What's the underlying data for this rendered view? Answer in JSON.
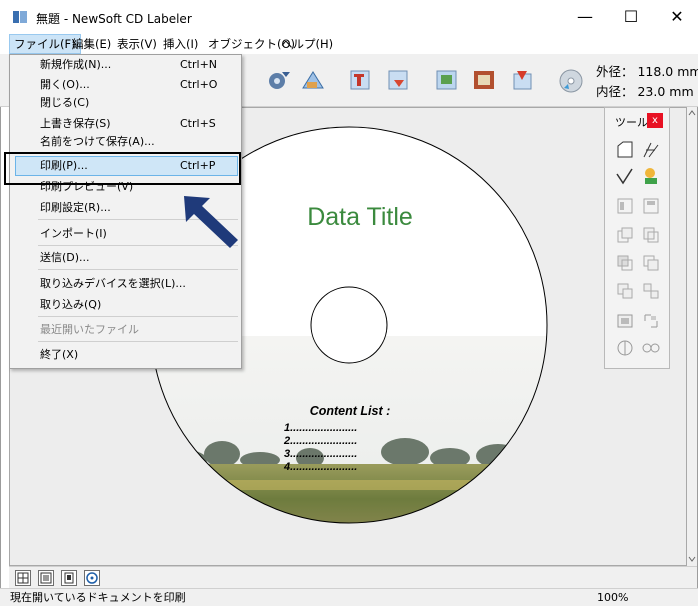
{
  "window": {
    "title": "無題 - NewSoft CD Labeler",
    "minimize_glyph": "—",
    "maximize_glyph": "☐",
    "close_glyph": "✕"
  },
  "menubar": {
    "items": [
      {
        "label": "ファイル(F)"
      },
      {
        "label": "編集(E)"
      },
      {
        "label": "表示(V)"
      },
      {
        "label": "挿入(I)"
      },
      {
        "label": "オブジェクト(O)"
      },
      {
        "label": "ヘルプ(H)"
      }
    ]
  },
  "toolbar": {
    "outer_diameter": "外径： 118.0 mm",
    "inner_diameter": "内径： 23.0 mm",
    "icons": [
      "rotate-left-icon",
      "flip-icon",
      "text-icon",
      "image-insert-icon",
      "photo-icon",
      "frame-icon",
      "background-icon",
      "disc-settings-icon"
    ]
  },
  "file_menu": {
    "items": [
      {
        "label": "新規作成(N)...",
        "shortcut": "Ctrl+N"
      },
      {
        "label": "開く(O)...",
        "shortcut": "Ctrl+O"
      },
      {
        "label": "閉じる(C)",
        "shortcut": ""
      },
      {
        "label": "上書き保存(S)",
        "shortcut": "Ctrl+S"
      },
      {
        "label": "名前をつけて保存(A)...",
        "shortcut": ""
      },
      {
        "label": "印刷(P)...",
        "shortcut": "Ctrl+P"
      },
      {
        "label": "印刷プレビュー(V)",
        "shortcut": ""
      },
      {
        "label": "印刷設定(R)...",
        "shortcut": ""
      },
      {
        "label": "インポート(I)",
        "shortcut": ""
      },
      {
        "label": "送信(D)...",
        "shortcut": ""
      },
      {
        "label": "取り込みデバイスを選択(L)...",
        "shortcut": ""
      },
      {
        "label": "取り込み(Q)",
        "shortcut": ""
      },
      {
        "label": "最近開いたファイル",
        "shortcut": ""
      },
      {
        "label": "終了(X)",
        "shortcut": ""
      }
    ]
  },
  "label": {
    "title": "Data Title",
    "content_heading": "Content List :",
    "content_lines": [
      "1......................",
      "2......................",
      "3......................",
      "4......................"
    ],
    "title_color": "#3b8a3e"
  },
  "palette": {
    "title": "ツール...",
    "close_glyph": "x"
  },
  "statusbar": {
    "message": "現在開いているドキュメントを印刷",
    "zoom": "100%"
  },
  "colors": {
    "arrow": "#1f3a7a",
    "menu_highlight": "#cfe6f7",
    "close_red": "#e81123"
  }
}
